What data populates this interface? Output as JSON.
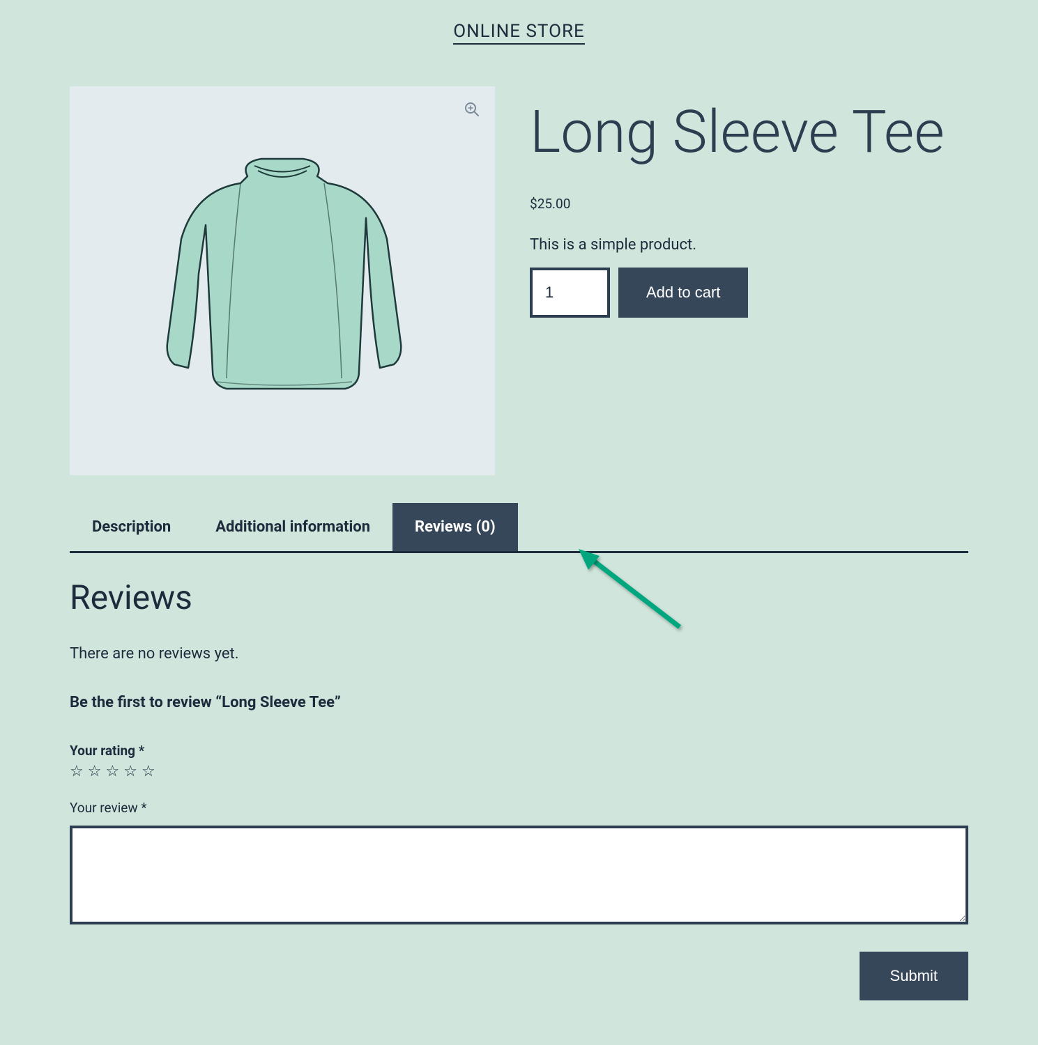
{
  "header": {
    "site_title": "ONLINE STORE"
  },
  "product": {
    "title": "Long Sleeve Tee",
    "currency": "$",
    "price": "25.00",
    "description": "This is a simple product.",
    "quantity": "1",
    "add_to_cart_label": "Add to cart"
  },
  "tabs": {
    "description": "Description",
    "additional_info": "Additional information",
    "reviews": "Reviews (0)"
  },
  "reviews": {
    "heading": "Reviews",
    "empty_text": "There are no reviews yet.",
    "prompt": "Be the first to review “Long Sleeve Tee”",
    "rating_label": "Your rating ",
    "rating_required": "*",
    "review_label": "Your review ",
    "review_required": "*",
    "submit_label": "Submit"
  },
  "colors": {
    "page_bg": "#d0e5dc",
    "panel_bg": "#e3ebee",
    "dark": "#37475a",
    "text": "#1e2b3c",
    "accent_arrow": "#00a67e"
  }
}
